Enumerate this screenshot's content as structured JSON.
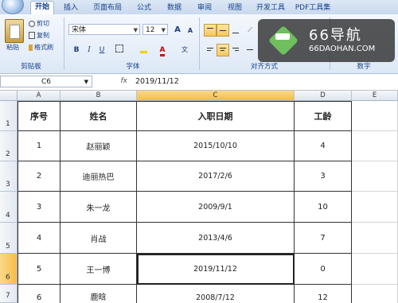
{
  "tabs": [
    "开始",
    "插入",
    "页面布局",
    "公式",
    "数据",
    "审阅",
    "视图",
    "开发工具",
    "PDF工具集"
  ],
  "clipboard": {
    "paste": "粘贴",
    "cut": "剪切",
    "copy": "复制",
    "format_painter": "格式刷",
    "group": "剪贴板"
  },
  "font": {
    "name": "宋体",
    "size": "12",
    "grow": "A",
    "shrink": "A",
    "bold": "B",
    "italic": "I",
    "underline": "U",
    "group": "字体"
  },
  "alignment": {
    "group": "对齐方式"
  },
  "number": {
    "group": "数字"
  },
  "watermark": {
    "title": "66导航",
    "subtitle": "66DAOHAN.COM"
  },
  "formula_bar": {
    "name_box": "C6",
    "fx": "fx",
    "value": "2019/11/12"
  },
  "columns": [
    "A",
    "B",
    "C",
    "D",
    "E"
  ],
  "rows": [
    "1",
    "2",
    "3",
    "4",
    "5",
    "6",
    "7"
  ],
  "table": {
    "headers": [
      "序号",
      "姓名",
      "入职日期",
      "工龄"
    ],
    "data": [
      [
        "1",
        "赵丽颖",
        "2015/10/10",
        "4"
      ],
      [
        "2",
        "迪丽热巴",
        "2017/2/6",
        "3"
      ],
      [
        "3",
        "朱一龙",
        "2009/9/1",
        "10"
      ],
      [
        "4",
        "肖战",
        "2013/4/6",
        "7"
      ],
      [
        "5",
        "王一博",
        "2019/11/12",
        "0"
      ],
      [
        "6",
        "鹿晗",
        "2008/7/12",
        "12"
      ]
    ]
  },
  "selection": {
    "cell": "C6",
    "column": "C",
    "row": "6"
  },
  "colors": {
    "ribbon": "#dde8f6",
    "tab_text": "#15428b",
    "header_selected": "#f5bc4a",
    "watermark_green": "#6fbf5e"
  }
}
